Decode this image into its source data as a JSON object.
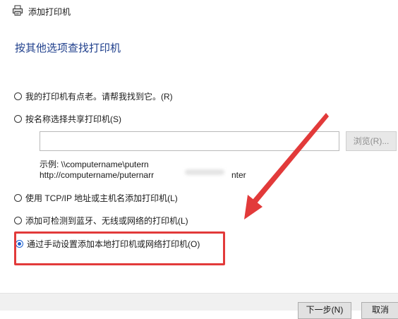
{
  "window": {
    "title": "添加打印机",
    "icon": "printer-icon"
  },
  "page_title": "按其他选项查找打印机",
  "options": [
    {
      "label": "我的打印机有点老。请帮我找到它。(R)",
      "selected": false
    },
    {
      "label": "按名称选择共享打印机(S)",
      "selected": false
    },
    {
      "label": "使用 TCP/IP 地址或主机名添加打印机(L)",
      "selected": false
    },
    {
      "label": "添加可检测到蓝牙、无线或网络的打印机(L)",
      "selected": false
    },
    {
      "label": "通过手动设置添加本地打印机或网络打印机(O)",
      "selected": true
    }
  ],
  "share_input": {
    "value": "",
    "placeholder": ""
  },
  "browse_label": "浏览(R)...",
  "example": {
    "line1": "示例: \\\\computername\\putern",
    "line2a": "http://computername/puternarr",
    "line2b": "nter"
  },
  "footer": {
    "next_label": "下一步(N)",
    "cancel_label": "取消"
  },
  "colors": {
    "title_blue": "#1f3f8c",
    "radio_accent": "#1a5fd0",
    "annotation_red": "#e23a3a"
  }
}
